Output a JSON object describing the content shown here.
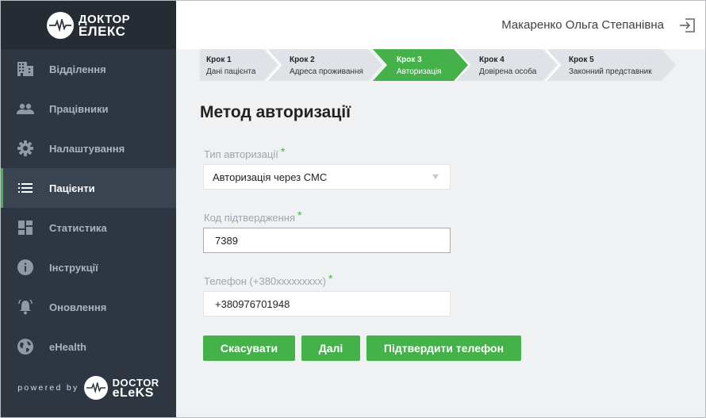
{
  "brand": {
    "logo_line1": "ДОКТОР",
    "logo_line2": "ЕЛЕКС",
    "powered_by": "powered by",
    "footer_line1": "DOCTOR",
    "footer_line2": "eLeKS"
  },
  "sidebar": {
    "items": [
      {
        "label": "Відділення",
        "icon": "building-icon",
        "active": false
      },
      {
        "label": "Працівники",
        "icon": "people-icon",
        "active": false
      },
      {
        "label": "Налаштування",
        "icon": "gear-icon",
        "active": false
      },
      {
        "label": "Пацієнти",
        "icon": "list-icon",
        "active": true
      },
      {
        "label": "Статистика",
        "icon": "dashboard-icon",
        "active": false
      },
      {
        "label": "Інструкції",
        "icon": "info-icon",
        "active": false
      },
      {
        "label": "Оновлення",
        "icon": "bell-icon",
        "active": false
      },
      {
        "label": "eHealth",
        "icon": "globe-icon",
        "active": false
      }
    ]
  },
  "header": {
    "user_name": "Макаренко Ольга Степанівна",
    "logout_icon": "logout-icon"
  },
  "steps": [
    {
      "num": "Крок 1",
      "name": "Дані пацієнта",
      "state": "done"
    },
    {
      "num": "Крок 2",
      "name": "Адреса проживання",
      "state": "done"
    },
    {
      "num": "Крок 3",
      "name": "Авторизація",
      "state": "active"
    },
    {
      "num": "Крок 4",
      "name": "Довірена особа",
      "state": "pending"
    },
    {
      "num": "Крок 5",
      "name": "Законний представник",
      "state": "pending"
    }
  ],
  "form": {
    "title": "Метод авторизації",
    "auth_type_label": "Тип авторизації",
    "auth_type_value": "Авторизація через СМС",
    "code_label": "Код підтвердження",
    "code_value": "7389",
    "phone_label": "Телефон (+380xxxxxxxxx)",
    "phone_value": "+380976701948",
    "required_mark": "*"
  },
  "buttons": {
    "cancel": "Скасувати",
    "next": "Далі",
    "confirm_phone": "Підтвердити телефон"
  },
  "colors": {
    "accent": "#44b14a",
    "sidebar_bg": "#2e3641",
    "sidebar_active": "#3a4350",
    "step_bg": "#dfe3e8"
  }
}
